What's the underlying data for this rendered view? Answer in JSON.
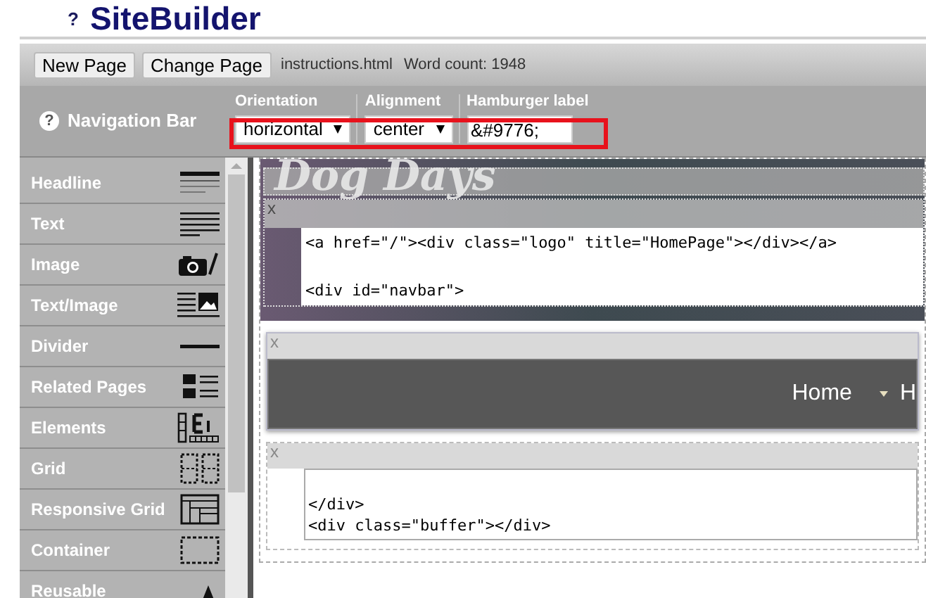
{
  "app": {
    "help": "?",
    "title": "SiteBuilder"
  },
  "toolbar": {
    "buttons": [
      "New Page",
      "Change Page"
    ],
    "filename": "instructions.html",
    "word_count": "Word count: 1948"
  },
  "properties": {
    "help": "?",
    "component": "Navigation Bar",
    "highlighted": true,
    "fields": [
      {
        "kind": "select",
        "label": "Orientation",
        "value": "horizontal"
      },
      {
        "kind": "select",
        "label": "Alignment",
        "value": "center"
      },
      {
        "kind": "text",
        "label": "Hamburger label",
        "value": "&#9776;"
      }
    ]
  },
  "palette": [
    {
      "label": "Headline",
      "kind": "headline"
    },
    {
      "label": "Text",
      "kind": "text"
    },
    {
      "label": "Image",
      "kind": "image"
    },
    {
      "label": "Text/Image",
      "kind": "textimage"
    },
    {
      "label": "Divider",
      "kind": "divider"
    },
    {
      "label": "Related Pages",
      "kind": "related"
    },
    {
      "label": "Elements",
      "kind": "elements"
    },
    {
      "label": "Grid",
      "kind": "grid"
    },
    {
      "label": "Responsive Grid",
      "kind": "rgrid"
    },
    {
      "label": "Container",
      "kind": "container"
    },
    {
      "label": "Reusable",
      "kind": "reusable"
    }
  ],
  "canvas": {
    "logo": "Dog Days",
    "blocks": [
      {
        "kind": "code",
        "close": "x",
        "code": "<a href=\"/\"><div class=\"logo\" title=\"HomePage\"></div></a>\n\n<div id=\"navbar\">"
      },
      {
        "kind": "nav",
        "close": "x",
        "links": [
          {
            "label": "Home",
            "dropdown": false
          },
          {
            "label": "H",
            "dropdown": true
          }
        ]
      },
      {
        "kind": "code",
        "close": "x",
        "code": "\n</div>\n<div class=\"buffer\"></div>"
      }
    ]
  }
}
